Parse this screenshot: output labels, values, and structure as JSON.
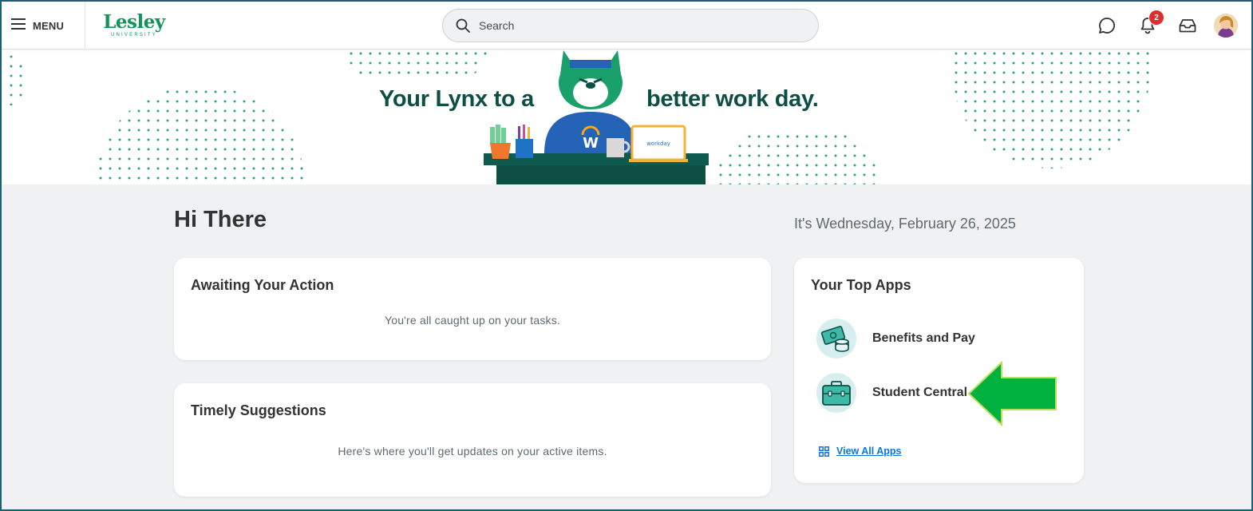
{
  "header": {
    "menu_label": "MENU",
    "logo_text": "Lesley",
    "logo_subtext": "UNIVERSITY",
    "search_placeholder": "Search",
    "notification_count": "2",
    "icons": [
      "menu-icon",
      "search-icon",
      "chat-icon",
      "bell-icon",
      "inbox-icon",
      "avatar"
    ]
  },
  "banner": {
    "text_left": "Your Lynx to a",
    "text_right": "better work day.",
    "mascot_shirt_letter": "W",
    "laptop_text": "workday"
  },
  "main": {
    "greeting": "Hi There",
    "date": "It's Wednesday, February 26, 2025"
  },
  "cards": {
    "awaiting": {
      "title": "Awaiting Your Action",
      "body": "You're all caught up on your tasks."
    },
    "timely": {
      "title": "Timely Suggestions",
      "body": "Here's where you'll get updates on your active items."
    },
    "top_apps": {
      "title": "Your Top Apps",
      "apps": [
        {
          "label": "Benefits and Pay",
          "icon": "money-icon"
        },
        {
          "label": "Student Central",
          "icon": "briefcase-icon"
        }
      ],
      "view_all_label": "View All Apps"
    }
  },
  "colors": {
    "brand_green": "#13955a",
    "banner_text": "#0d4f45",
    "link_blue": "#0875e1",
    "badge_red": "#de2d2d",
    "arrow_green": "#00b140",
    "page_bg": "#f0f1f2"
  }
}
